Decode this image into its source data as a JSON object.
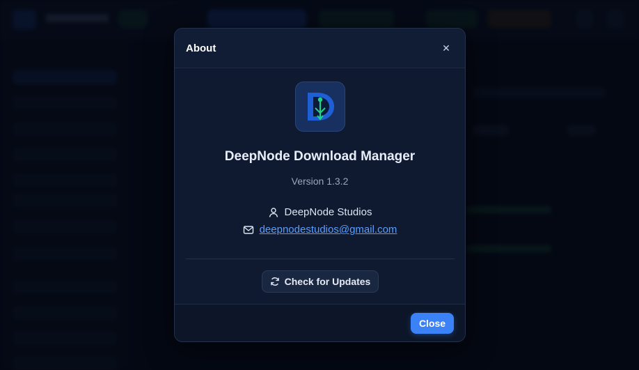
{
  "dialog": {
    "title": "About",
    "close_icon": "close-icon",
    "app_name": "DeepNode Download Manager",
    "version": "Version 1.3.2",
    "company": "DeepNode Studios",
    "company_icon": "user-icon",
    "email": "deepnodestudios@gmail.com",
    "email_icon": "mail-icon",
    "check_updates_label": "Check for Updates",
    "check_updates_icon": "refresh-icon",
    "close_label": "Close"
  },
  "colors": {
    "accent": "#3b82f6",
    "link": "#5b9dff",
    "dialog_bg": "#0f1a30",
    "page_bg": "#060b16",
    "logo_green": "#1fd38a"
  }
}
